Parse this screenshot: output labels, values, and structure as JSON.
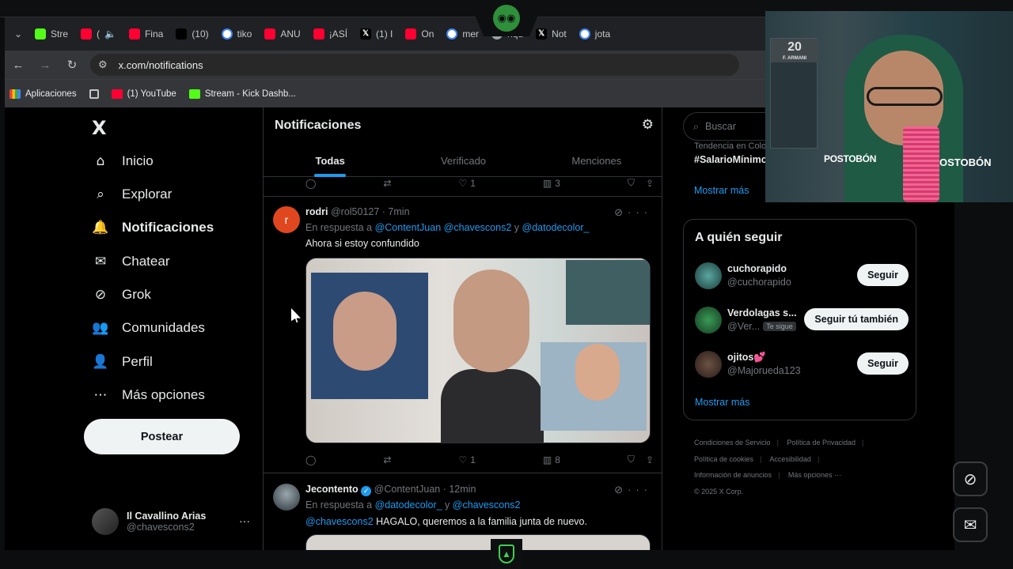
{
  "browser": {
    "tabs": [
      {
        "label": "Stre",
        "icon": "kick-icon",
        "color": "#53fc18"
      },
      {
        "label": "(",
        "icon": "youtube-icon",
        "color": "#ff0033",
        "audio": "🔈"
      },
      {
        "label": "Fina",
        "icon": "youtube-icon",
        "color": "#ff0033"
      },
      {
        "label": "(10)",
        "icon": "tiktok-icon",
        "color": "#000000"
      },
      {
        "label": "tiko",
        "icon": "google-icon",
        "color": "#ffffff"
      },
      {
        "label": "ANU",
        "icon": "youtube-icon",
        "color": "#ff0033"
      },
      {
        "label": "¡ASÍ",
        "icon": "youtube-icon",
        "color": "#ff0033"
      },
      {
        "label": "(1) I",
        "icon": "x-icon",
        "color": "#000000"
      },
      {
        "label": "On",
        "icon": "youtube-icon",
        "color": "#ff0033"
      },
      {
        "label": "mer",
        "icon": "google-icon",
        "color": "#ffffff"
      },
      {
        "label": "hqd",
        "icon": "globe-icon",
        "color": "#9aa0a6"
      },
      {
        "label": "Not",
        "icon": "x-icon",
        "color": "#000000"
      },
      {
        "label": "jota",
        "icon": "google-icon",
        "color": "#ffffff"
      }
    ],
    "url": "x.com/notifications",
    "bookmarks": [
      {
        "label": "Aplicaciones",
        "icon": "apps-grid-icon"
      },
      {
        "label": "",
        "icon": "grid-icon"
      },
      {
        "label": "(1) YouTube",
        "icon": "youtube-icon"
      },
      {
        "label": "Stream - Kick Dashb...",
        "icon": "kick-icon"
      }
    ]
  },
  "sidebar": {
    "logo": "X",
    "items": [
      {
        "label": "Inicio",
        "icon": "home-icon",
        "glyph": "⌂"
      },
      {
        "label": "Explorar",
        "icon": "search-icon",
        "glyph": "⌕"
      },
      {
        "label": "Notificaciones",
        "icon": "bell-icon",
        "glyph": "🔔",
        "active": true
      },
      {
        "label": "Chatear",
        "icon": "mail-icon",
        "glyph": "✉"
      },
      {
        "label": "Grok",
        "icon": "grok-icon",
        "glyph": "⊘"
      },
      {
        "label": "Comunidades",
        "icon": "communities-icon",
        "glyph": "👥"
      },
      {
        "label": "Perfil",
        "icon": "profile-icon",
        "glyph": "👤"
      },
      {
        "label": "Más opciones",
        "icon": "more-circle-icon",
        "glyph": "⋯"
      }
    ],
    "post_button": "Postear",
    "account": {
      "name": "Il Cavallino Arias",
      "handle": "@chavescons2",
      "menu": "···"
    }
  },
  "main": {
    "title": "Notificaciones",
    "tabs": [
      "Todas",
      "Verificado",
      "Menciones"
    ],
    "active_tab": "Todas",
    "top_actions": {
      "likes": "1",
      "views": "3"
    },
    "posts": [
      {
        "name": "rodri",
        "handle": "@rol50127",
        "time": "· 7min",
        "avatar_letter": "r",
        "avatar_color": "#e0471f",
        "reply_prefix": "En respuesta a",
        "reply_mentions": "@ContentJuan @chavescons2",
        "reply_and": "y",
        "reply_last": "@datodecolor_",
        "text": "Ahora si estoy confundido",
        "likes": "1",
        "views": "8"
      },
      {
        "name": "Jecontento",
        "handle": "@ContentJuan",
        "time": "· 12min",
        "reply_prefix": "En respuesta a",
        "reply_mentions": "@datodecolor_",
        "reply_and": "y",
        "reply_last": "@chavescons2",
        "text_mention": "@chavescons2",
        "text": "HAGALO, queremos a la familia junta de nuevo."
      }
    ]
  },
  "right": {
    "search_placeholder": "Buscar",
    "trend_sub": "Tendencia en Colo",
    "trend_tag": "#SalarioMínimo",
    "trend_more": "Mostrar más",
    "follow_title": "A quién seguir",
    "follow": [
      {
        "name": "cuchorapido",
        "handle": "@cuchorapido",
        "button": "Seguir",
        "badge": ""
      },
      {
        "name": "Verdolagas s...",
        "handle": "@Ver...",
        "button": "Seguir tú también",
        "badge": "Te sigue"
      },
      {
        "name": "ojitos💕",
        "handle": "@Majorueda123",
        "button": "Seguir",
        "badge": ""
      }
    ],
    "follow_more": "Mostrar más",
    "footer": [
      "Condiciones de Servicio",
      "Política de Privacidad",
      "Política de cookies",
      "Accesibilidad",
      "Información de anuncios",
      "Más opciones ···",
      "© 2025 X Corp."
    ]
  },
  "webcam": {
    "jersey": "20",
    "jersey_name": "F. ARMANI",
    "brand": "POSTOBÓN",
    "brand_right": "OSTOBÓN"
  },
  "colors": {
    "accent": "#1d9bf0",
    "kick": "#53fc18",
    "bg": "#000000"
  }
}
